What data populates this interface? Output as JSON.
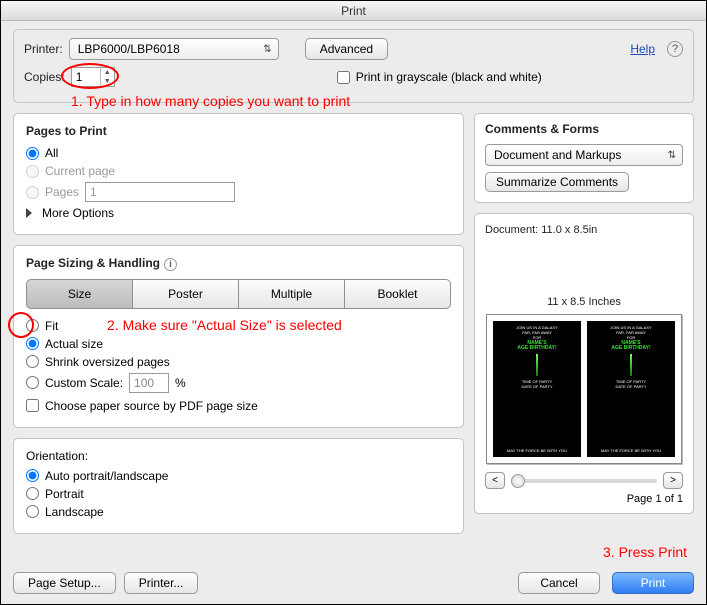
{
  "title": "Print",
  "header": {
    "printer_label": "Printer:",
    "printer_value": "LBP6000/LBP6018",
    "advanced": "Advanced",
    "help": "Help",
    "copies_label": "Copies:",
    "copies_value": "1",
    "grayscale": "Print in grayscale (black and white)"
  },
  "annotations": {
    "a1": "1. Type in how many copies you want to print",
    "a2": "2. Make sure \"Actual Size\" is selected",
    "a3": "3. Press Print"
  },
  "pages": {
    "heading": "Pages to Print",
    "all": "All",
    "current": "Current page",
    "pages": "Pages",
    "pages_value": "1",
    "more": "More Options"
  },
  "sizing": {
    "heading": "Page Sizing & Handling",
    "seg": {
      "size": "Size",
      "poster": "Poster",
      "multiple": "Multiple",
      "booklet": "Booklet"
    },
    "fit": "Fit",
    "actual": "Actual size",
    "shrink": "Shrink oversized pages",
    "custom": "Custom Scale:",
    "scale_value": "100",
    "percent": "%",
    "choose_source": "Choose paper source by PDF page size"
  },
  "orientation": {
    "heading": "Orientation:",
    "auto": "Auto portrait/landscape",
    "portrait": "Portrait",
    "landscape": "Landscape"
  },
  "comments": {
    "heading": "Comments & Forms",
    "dropdown": "Document and Markups",
    "summarize": "Summarize Comments"
  },
  "preview": {
    "doc_dims": "Document: 11.0 x 8.5in",
    "caption": "11 x 8.5 Inches",
    "page_label": "Page 1 of 1",
    "prev": "<",
    "next": ">"
  },
  "footer": {
    "page_setup": "Page Setup...",
    "printer": "Printer...",
    "cancel": "Cancel",
    "print": "Print"
  }
}
